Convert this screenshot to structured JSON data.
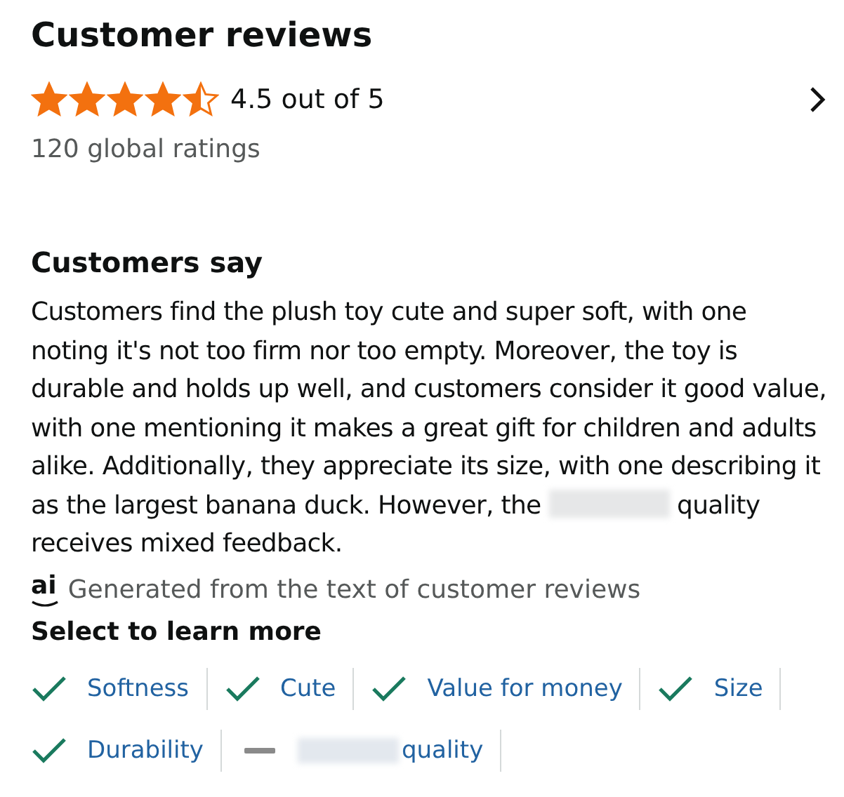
{
  "header": {
    "title": "Customer reviews",
    "stars": 4.5,
    "rating_text": "4.5 out of 5",
    "ratings_count": "120 global ratings"
  },
  "summary": {
    "title": "Customers say",
    "segments": [
      "Customers find the plush toy cute and super soft, with one noting it's not too firm nor too empty. Moreover, the toy is durable and holds up well, and customers consider it good value, with one mentioning it makes a great gift for children and adults alike. Additionally, they appreciate its size, with one describing it as the largest banana duck. However, the",
      "quality receives mixed feedback."
    ],
    "ai_mark": "ai",
    "ai_note": "Generated from the text of customer reviews"
  },
  "aspects": {
    "title": "Select to learn more",
    "items": [
      {
        "label": "Softness",
        "kind": "positive",
        "blurred_prefix": false
      },
      {
        "label": "Cute",
        "kind": "positive",
        "blurred_prefix": false
      },
      {
        "label": "Value for money",
        "kind": "positive",
        "blurred_prefix": false
      },
      {
        "label": "Size",
        "kind": "positive",
        "blurred_prefix": false
      },
      {
        "label": "Durability",
        "kind": "positive",
        "blurred_prefix": false
      },
      {
        "label": "quality",
        "kind": "mixed",
        "blurred_prefix": true
      }
    ]
  }
}
